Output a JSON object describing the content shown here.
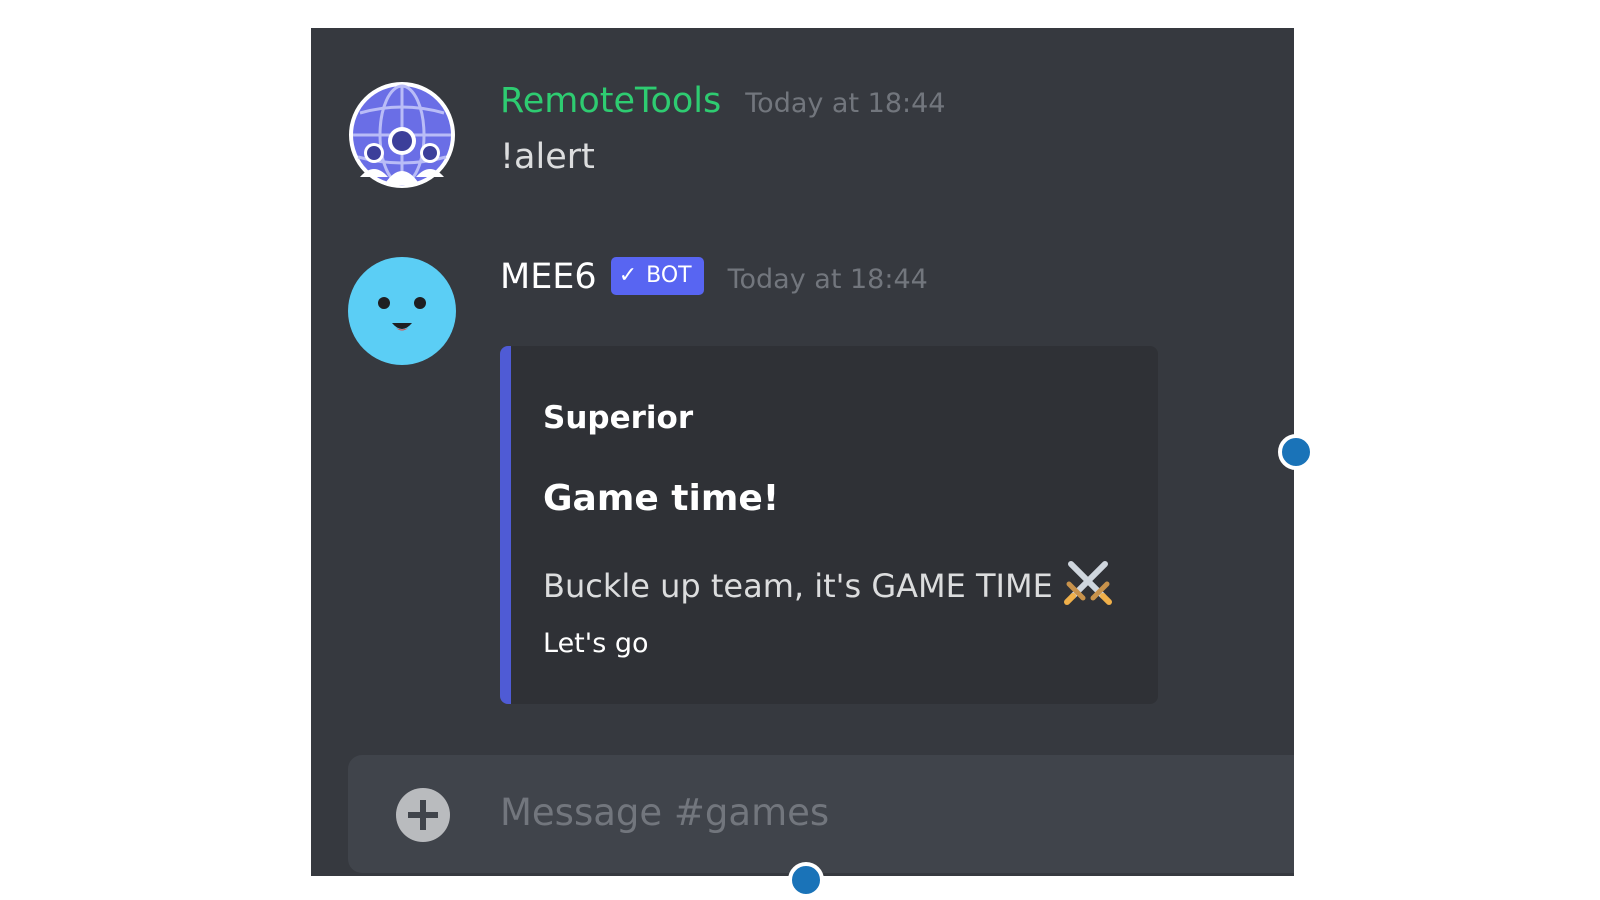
{
  "messages": [
    {
      "username": "RemoteTools",
      "timestamp": "Today at 18:44",
      "text": "!alert",
      "avatar_icon": "globe-people-avatar-icon",
      "username_color": "#2ecc71"
    },
    {
      "username": "MEE6",
      "bot_badge": {
        "check": "✓",
        "label": "BOT"
      },
      "timestamp": "Today at 18:44",
      "avatar_icon": "smiley-face-avatar-icon",
      "embed": {
        "author": "Superior",
        "title": "Game time!",
        "description": "Buckle up team, it's GAME TIME",
        "description_icon": "crossed-swords-icon",
        "field": "Let's go",
        "accent_color": "#4f5bd5"
      }
    }
  ],
  "input": {
    "placeholder": "Message #games",
    "attach_icon": "plus-circle-icon"
  },
  "colors": {
    "background": "#36393f",
    "embed_bg": "#2f3136",
    "input_bg": "#40444b",
    "bot_badge": "#5865f2",
    "handle": "#1a73b8"
  }
}
